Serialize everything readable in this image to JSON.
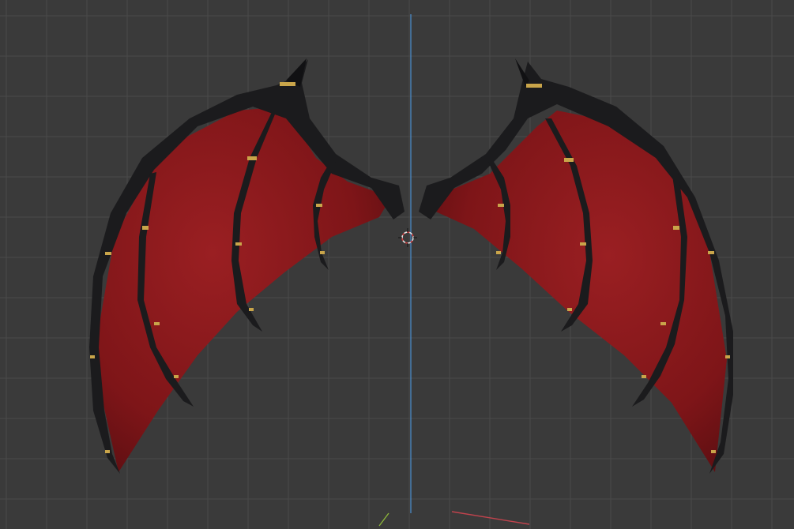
{
  "viewport": {
    "background_color": "#3a3a3a",
    "grid_color": "#4a4a4a",
    "z_axis_color": "#4a8fd0",
    "x_axis_color": "#c0434d",
    "y_axis_color": "#8bb33a",
    "object": "demon-wings-model",
    "wing_membrane_color": "#8a1a1c",
    "wing_bone_color": "#1b1b1d",
    "band_color": "#c9a54a",
    "cursor": "3d-cursor"
  }
}
